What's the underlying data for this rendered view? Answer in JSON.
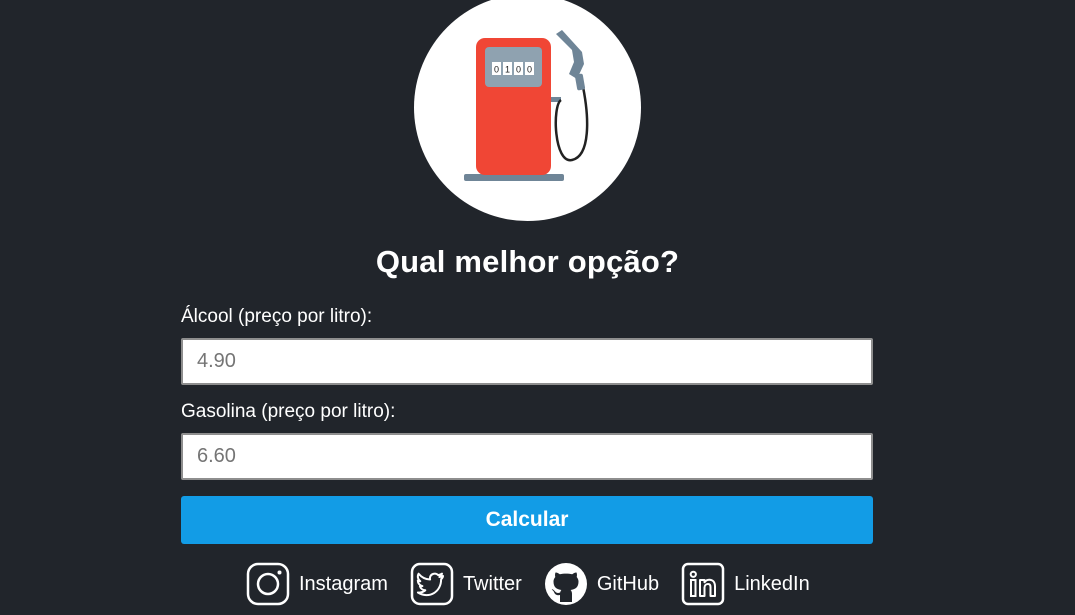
{
  "logo": {
    "icon": "gas-pump-icon",
    "counter_digits": [
      "0",
      "1",
      "0",
      "0"
    ],
    "colors": {
      "pump": "#f04635",
      "grey": "#6f8597",
      "background": "#ffffff"
    }
  },
  "form": {
    "title": "Qual melhor opção?",
    "alcohol": {
      "label": "Álcool (preço por litro):",
      "placeholder": "4.90",
      "value": ""
    },
    "gasoline": {
      "label": "Gasolina (preço por litro):",
      "placeholder": "6.60",
      "value": ""
    },
    "submit_label": "Calcular"
  },
  "socials": [
    {
      "icon": "instagram-icon",
      "label": "Instagram"
    },
    {
      "icon": "twitter-icon",
      "label": "Twitter"
    },
    {
      "icon": "github-icon",
      "label": "GitHub"
    },
    {
      "icon": "linkedin-icon",
      "label": "LinkedIn"
    }
  ],
  "colors": {
    "background": "#21252b",
    "button": "#129ce6",
    "text": "#ffffff"
  }
}
